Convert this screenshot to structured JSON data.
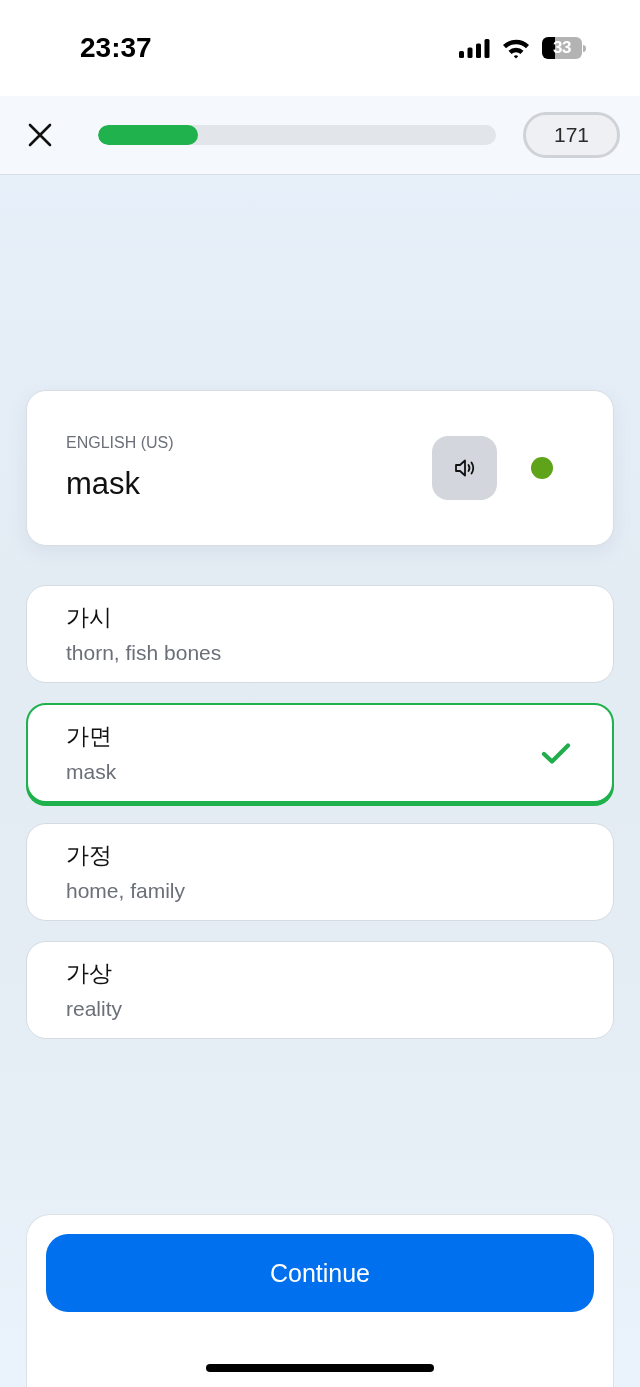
{
  "status_bar": {
    "time": "23:37",
    "battery": "33"
  },
  "header": {
    "progress": {
      "level": 0.25
    },
    "count": "171"
  },
  "prompt": {
    "language": "ENGLISH (US)",
    "word": "mask"
  },
  "options": [
    {
      "word": "가시",
      "meaning": "thorn, fish bones",
      "selected": false
    },
    {
      "word": "가면",
      "meaning": "mask",
      "selected": true
    },
    {
      "word": "가정",
      "meaning": "home, family",
      "selected": false
    },
    {
      "word": "가상",
      "meaning": "reality",
      "selected": false
    }
  ],
  "continue_button": {
    "label": "Continue"
  }
}
